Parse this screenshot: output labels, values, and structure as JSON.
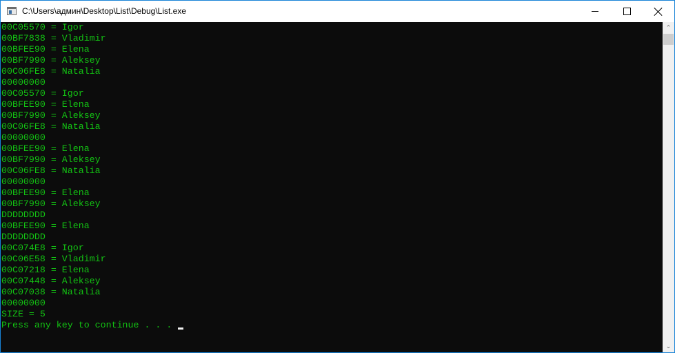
{
  "window": {
    "title": "C:\\Users\\админ\\Desktop\\List\\Debug\\List.exe",
    "controls": {
      "minimize": "minimize",
      "maximize": "maximize",
      "close": "close"
    }
  },
  "console": {
    "text_color": "#13c313",
    "background": "#0c0c0c",
    "lines": [
      "00C05570 = Igor",
      "00BF7838 = Vladimir",
      "00BFEE90 = Elena",
      "00BF7990 = Aleksey",
      "00C06FE8 = Natalia",
      "00000000",
      "00C05570 = Igor",
      "00BFEE90 = Elena",
      "00BF7990 = Aleksey",
      "00C06FE8 = Natalia",
      "00000000",
      "00BFEE90 = Elena",
      "00BF7990 = Aleksey",
      "00C06FE8 = Natalia",
      "00000000",
      "00BFEE90 = Elena",
      "00BF7990 = Aleksey",
      "DDDDDDDD",
      "00BFEE90 = Elena",
      "DDDDDDDD",
      "00C074E8 = Igor",
      "00C06E58 = Vladimir",
      "00C07218 = Elena",
      "00C07448 = Aleksey",
      "00C07038 = Natalia",
      "00000000",
      "SIZE = 5",
      "Press any key to continue . . . "
    ]
  },
  "scrollbar": {
    "up_glyph": "⌃",
    "down_glyph": "⌄"
  }
}
